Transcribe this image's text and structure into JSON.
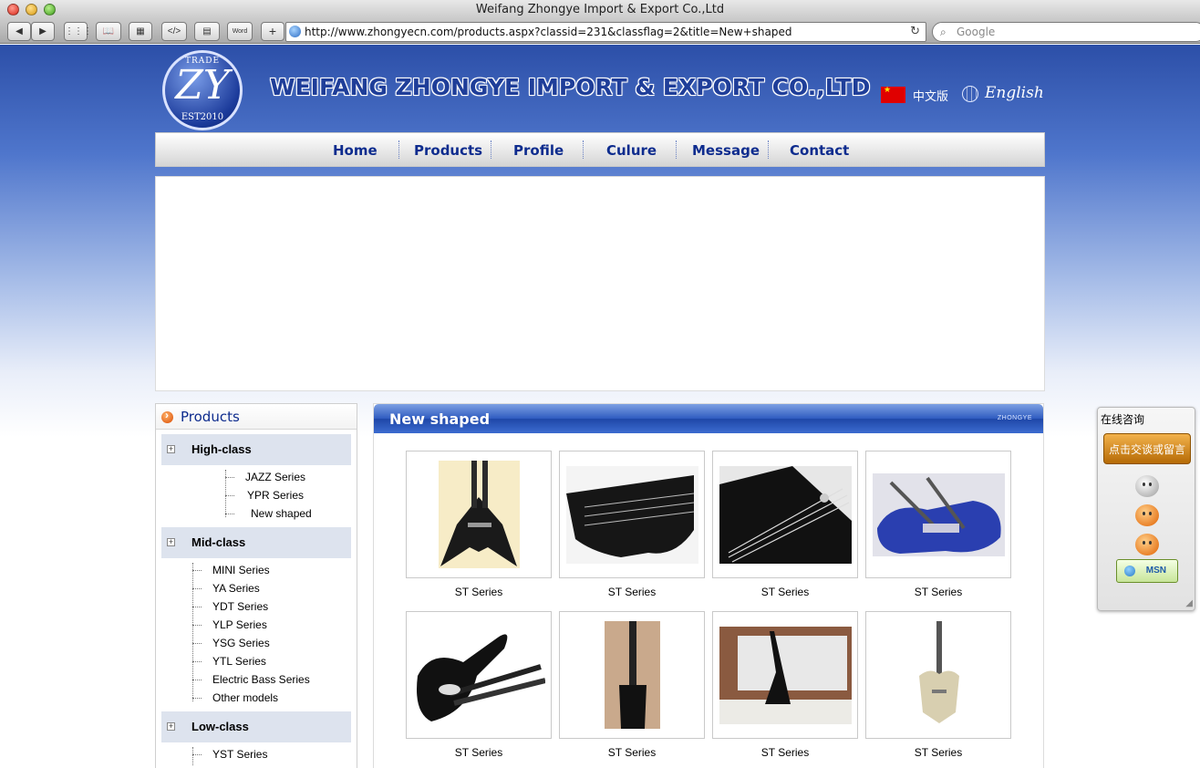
{
  "window": {
    "title": "Weifang Zhongye Import & Export Co.,Ltd"
  },
  "toolbar": {
    "url": "http://www.zhongyecn.com/products.aspx?classid=231&classflag=2&title=New+shaped",
    "search_placeholder": "Google",
    "word_label": "Word",
    "add_label": "+"
  },
  "header": {
    "logo_top": "TRADE",
    "logo_main": "ZY",
    "logo_bottom": "EST2010",
    "company_name": "WEIFANG ZHONGYE IMPORT & EXPORT CO.,LTD",
    "lang_cn": "中文版",
    "lang_en": "English",
    "flag_color": "#e00000"
  },
  "nav": {
    "items": [
      {
        "label": "Home"
      },
      {
        "label": "Products"
      },
      {
        "label": "Profile"
      },
      {
        "label": "Culure"
      },
      {
        "label": "Message"
      },
      {
        "label": "Contact"
      }
    ]
  },
  "sidebar": {
    "title": "Products",
    "categories": [
      {
        "label": "High-class",
        "items": [
          "JAZZ Series",
          "YPR Series",
          "New shaped"
        ]
      },
      {
        "label": "Mid-class",
        "items": [
          "MINI Series",
          "YA Series",
          "YDT Series",
          "YLP Series",
          "YSG Series",
          "YTL Series",
          "Electric Bass Series",
          "Other models"
        ]
      },
      {
        "label": "Low-class",
        "items": [
          "YST Series"
        ]
      }
    ]
  },
  "content": {
    "title": "New shaped",
    "tag": "ZHONGYE",
    "products": [
      {
        "label": "ST Series"
      },
      {
        "label": "ST Series"
      },
      {
        "label": "ST Series"
      },
      {
        "label": "ST Series"
      },
      {
        "label": "ST Series"
      },
      {
        "label": "ST Series"
      },
      {
        "label": "ST Series"
      },
      {
        "label": "ST Series"
      }
    ]
  },
  "chat": {
    "tab_label": "在线咨询",
    "button_label": "点击交谈或留言",
    "msn_label": "MSN"
  },
  "colors": {
    "nav_text": "#0e2c8e",
    "header_blue": "#2c4fa8",
    "chat_button": "#d98a1c"
  }
}
